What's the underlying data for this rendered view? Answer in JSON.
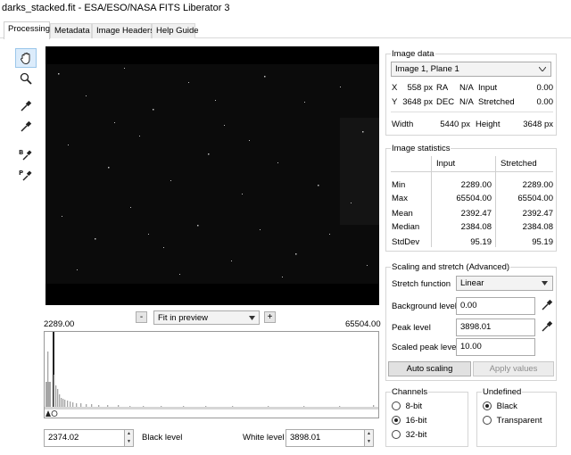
{
  "window": {
    "title": "darks_stacked.fit - ESA/ESO/NASA FITS Liberator 3"
  },
  "tabs": [
    "Processing",
    "Metadata",
    "Image Headers",
    "Help Guide"
  ],
  "tools": [
    {
      "name": "hand-tool-icon"
    },
    {
      "name": "zoom-tool-icon"
    },
    {
      "name": "pick-eyedropper-icon"
    },
    {
      "name": "pick-eyedropper-alt-icon"
    },
    {
      "name": "background-eyedropper-icon",
      "letter": "B"
    },
    {
      "name": "peak-eyedropper-icon",
      "letter": "P"
    }
  ],
  "preview": {
    "minus_label": "-",
    "fit_option": "Fit in preview",
    "plus_label": "+",
    "range_min": "2289.00",
    "range_max": "65504.00"
  },
  "levels": {
    "black_value": "2374.02",
    "black_label": "Black level",
    "white_label": "White level",
    "white_value": "3898.01"
  },
  "image_data": {
    "title": "Image data",
    "plane": "Image 1, Plane 1",
    "x_label": "X",
    "x_value": "558 px",
    "ra_label": "RA",
    "ra_value": "N/A",
    "input_label": "Input",
    "input_value": "0.00",
    "y_label": "Y",
    "y_value": "3648 px",
    "dec_label": "DEC",
    "dec_value": "N/A",
    "stretched_label": "Stretched",
    "stretched_value": "0.00",
    "width_label": "Width",
    "width_value": "5440 px",
    "height_label": "Height",
    "height_value": "3648 px"
  },
  "stats": {
    "title": "Image statistics",
    "col_input": "Input",
    "col_stretched": "Stretched",
    "rows": [
      {
        "label": "Min",
        "input": "2289.00",
        "stretched": "2289.00"
      },
      {
        "label": "Max",
        "input": "65504.00",
        "stretched": "65504.00"
      },
      {
        "label": "Mean",
        "input": "2392.47",
        "stretched": "2392.47"
      },
      {
        "label": "Median",
        "input": "2384.08",
        "stretched": "2384.08"
      },
      {
        "label": "StdDev",
        "input": "95.19",
        "stretched": "95.19"
      }
    ]
  },
  "scaling": {
    "title": "Scaling and stretch (Advanced)",
    "stretch_label": "Stretch function",
    "stretch_value": "Linear",
    "background_label": "Background level",
    "background_value": "0.00",
    "peak_label": "Peak level",
    "peak_value": "3898.01",
    "scaled_peak_label": "Scaled peak level",
    "scaled_peak_value": "10.00",
    "auto_button": "Auto scaling",
    "apply_button": "Apply values"
  },
  "channels": {
    "title": "Channels",
    "options": [
      "8-bit",
      "16-bit",
      "32-bit"
    ],
    "selected": "16-bit"
  },
  "undefined": {
    "title": "Undefined",
    "options": [
      "Black",
      "Transparent"
    ],
    "selected": "Black"
  },
  "colors": {
    "preview_bg": "#000000",
    "histogram_bar": "#a5a5a5",
    "accent_highlight": "#dcecfb"
  }
}
